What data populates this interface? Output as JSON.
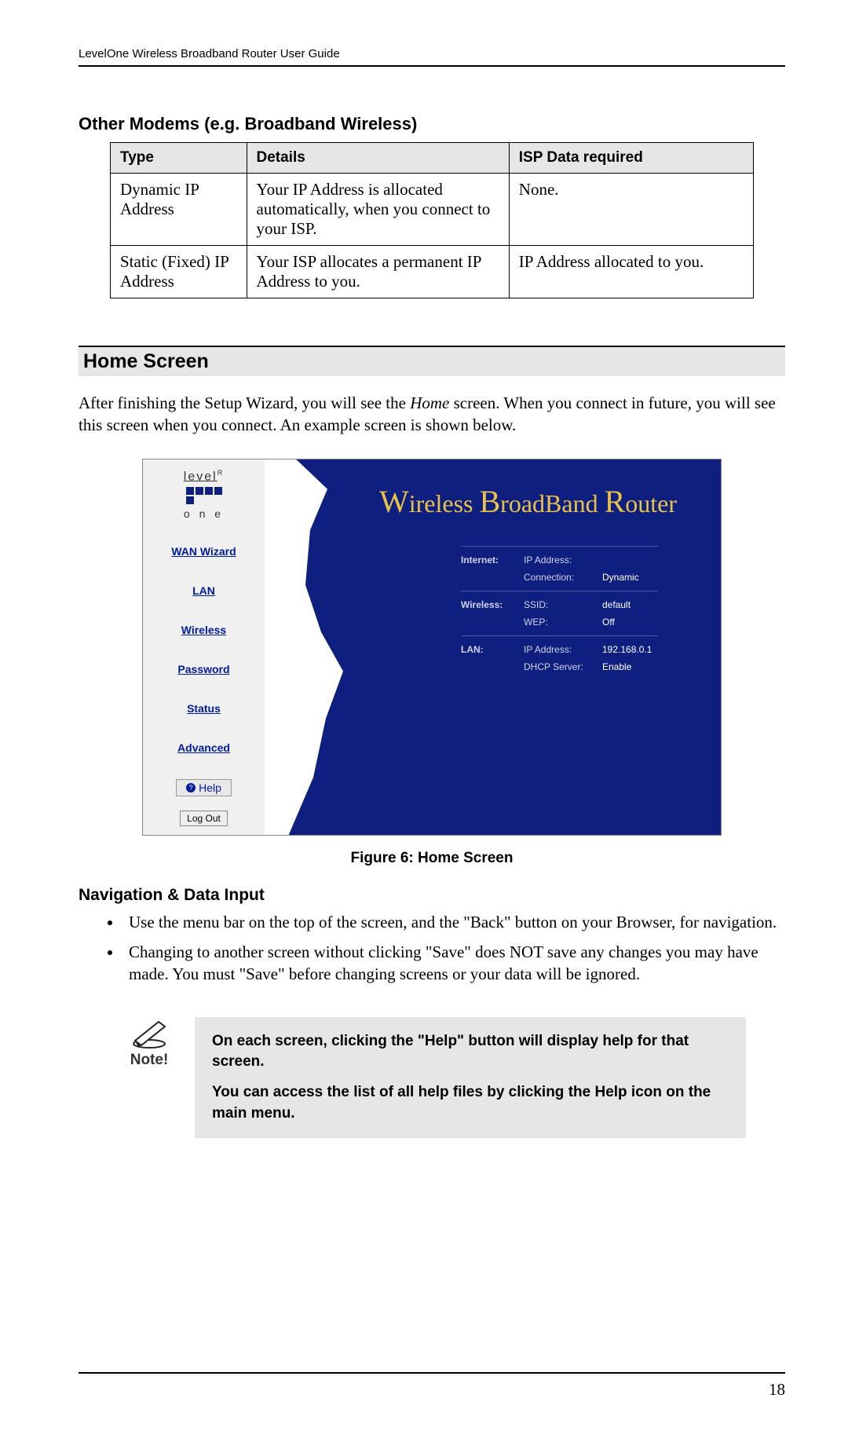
{
  "header": {
    "running": "LevelOne Wireless Broadband Router User Guide"
  },
  "section_other_modems": {
    "title": "Other Modems (e.g. Broadband Wireless)",
    "columns": {
      "type": "Type",
      "details": "Details",
      "isp": "ISP Data required"
    },
    "rows": [
      {
        "type": "Dynamic IP Address",
        "details": "Your IP Address is allocated automatically, when you connect to your ISP.",
        "isp": "None."
      },
      {
        "type": "Static (Fixed) IP Address",
        "details": "Your ISP allocates a permanent IP Address to you.",
        "isp": "IP Address allocated to you."
      }
    ]
  },
  "section_home": {
    "title": "Home Screen",
    "intro_before_italic": "After finishing the Setup Wizard, you will see the ",
    "intro_italic": "Home",
    "intro_after_italic": " screen. When you connect in future, you will see this screen when you connect. An example screen is shown below.",
    "figure_caption": "Figure 6: Home Screen"
  },
  "router_ui": {
    "logo_top": "level",
    "logo_sup": "R",
    "logo_bottom": "o n e",
    "nav": {
      "wan": "WAN Wizard",
      "lan": "LAN",
      "wireless": "Wireless",
      "password": "Password",
      "status": "Status",
      "advanced": "Advanced"
    },
    "help_label": "Help",
    "logout_label": "Log Out",
    "title_w": "W",
    "title_ireless": "ireless ",
    "title_b": "B",
    "title_roadband": "roadBand ",
    "title_r": "R",
    "title_outer": "outer",
    "status": {
      "internet": {
        "label": "Internet:",
        "ip_label": "IP Address:",
        "ip_value": "",
        "conn_label": "Connection:",
        "conn_value": "Dynamic"
      },
      "wireless": {
        "label": "Wireless:",
        "ssid_label": "SSID:",
        "ssid_value": "default",
        "wep_label": "WEP:",
        "wep_value": "Off"
      },
      "lan": {
        "label": "LAN:",
        "ip_label": "IP Address:",
        "ip_value": "192.168.0.1",
        "dhcp_label": "DHCP Server:",
        "dhcp_value": "Enable"
      }
    }
  },
  "navigation_section": {
    "title": "Navigation & Data Input",
    "bullets": [
      "Use the menu bar on the top of the screen, and the \"Back\" button on your Browser, for navigation.",
      "Changing to another screen without clicking \"Save\" does NOT save any changes you may have made. You must \"Save\" before changing screens or your data will be ignored."
    ]
  },
  "note": {
    "label": "Note!",
    "p1": "On each screen, clicking the \"Help\" button will display help for that screen.",
    "p2": "You can access the list of all help files by clicking the Help icon on the main menu."
  },
  "page_number": "18"
}
